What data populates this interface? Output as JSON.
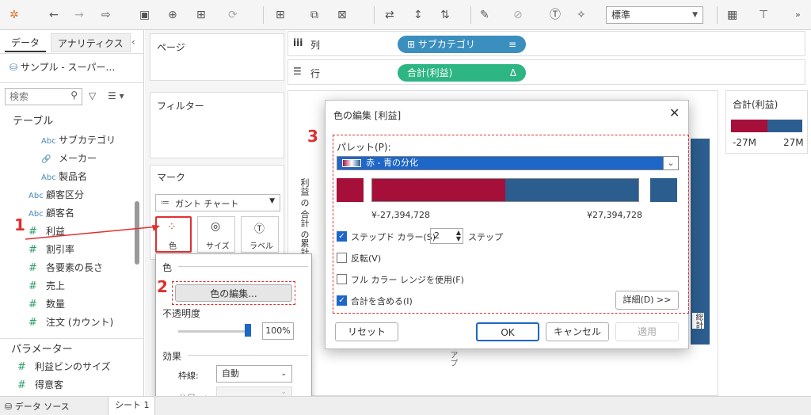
{
  "toolbar": {
    "font_select": "標準"
  },
  "left": {
    "tabs": [
      "データ",
      "アナリティクス"
    ],
    "datasource": "サンプル - スーパー…",
    "search_placeholder": "検索",
    "table_header": "テーブル",
    "fields": [
      {
        "type": "Abc",
        "name": "サブカテゴリ",
        "indent": true
      },
      {
        "type": "link",
        "name": "メーカー",
        "indent": true
      },
      {
        "type": "Abc",
        "name": "製品名",
        "indent": true
      },
      {
        "type": "Abc",
        "name": "顧客区分",
        "indent": false
      },
      {
        "type": "Abc",
        "name": "顧客名",
        "indent": false
      },
      {
        "type": "#",
        "name": "利益",
        "indent": false
      },
      {
        "type": "#",
        "name": "割引率",
        "indent": false
      },
      {
        "type": "#",
        "name": "各要素の長さ",
        "indent": false
      },
      {
        "type": "#",
        "name": "売上",
        "indent": false
      },
      {
        "type": "#",
        "name": "数量",
        "indent": false
      },
      {
        "type": "#",
        "name": "注文 (カウント)",
        "indent": false
      }
    ],
    "parameters_header": "パラメーター",
    "parameters": [
      "利益ビンのサイズ",
      "得意客"
    ]
  },
  "shelves": {
    "pages": "ページ",
    "filters": "フィルター",
    "marks": "マーク",
    "mark_type": "ガント チャート",
    "mark_buttons": [
      "色",
      "サイズ",
      "ラベル"
    ],
    "columns_label": "列",
    "rows_label": "行",
    "columns_pill": "サブカテゴリ",
    "rows_pill": "合計(利益)"
  },
  "view": {
    "axis_title": "利益 の 合計 の累計",
    "total_label": "総計",
    "axis_bottom": "アプ"
  },
  "legend": {
    "title": "合計(利益)",
    "min": "-27M",
    "max": "27M"
  },
  "color_popup": {
    "color_label": "色",
    "edit_button": "色の編集...",
    "opacity_label": "不透明度",
    "opacity_value": "100%",
    "effects_label": "効果",
    "border_label": "枠線:",
    "border_value": "自動",
    "halo_label": "ハロー:"
  },
  "dialog": {
    "title": "色の編集 [利益]",
    "palette_label": "パレット(P):",
    "palette_value": "赤 - 青の分化",
    "range_min": "¥-27,394,728",
    "range_max": "¥27,394,728",
    "stepped_label": "ステップド カラー(S)",
    "stepped_value": "2",
    "step_unit": "ステップ",
    "reverse_label": "反転(V)",
    "full_range_label": "フル カラー レンジを使用(F)",
    "include_totals_label": "合計を含める(I)",
    "details_button": "詳細(D) >>",
    "reset_button": "リセット",
    "ok_button": "OK",
    "cancel_button": "キャンセル",
    "apply_button": "適用"
  },
  "annotations": [
    "1",
    "2",
    "3"
  ],
  "status": {
    "datasource_tab": "データ ソース",
    "sheet_tab": "シート 1"
  },
  "colors": {
    "red": "#a50f3a",
    "blue": "#2c5d8f",
    "accent": "#1e66c8",
    "pill_green": "#2db583",
    "pill_blue": "#3b8fbf"
  }
}
